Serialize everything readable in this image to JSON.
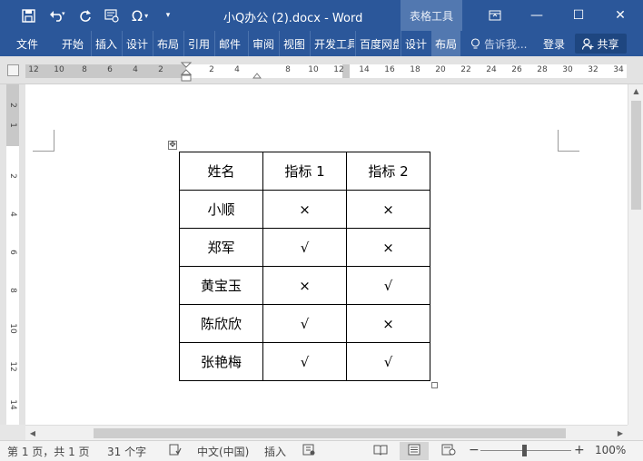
{
  "app": {
    "title": "小Q办公 (2).docx - Word",
    "context_tab": "表格工具"
  },
  "quick_access": {
    "save_icon": "save-icon",
    "undo_icon": "undo-icon",
    "redo_icon": "redo-icon",
    "omega_icon": "symbol-icon",
    "customize_icon": "customize-icon"
  },
  "window_controls": {
    "ribbon_display": "▭",
    "minimize": "—",
    "maximize": "☐",
    "close": "✕"
  },
  "ribbon": {
    "tabs": [
      "文件",
      "开始",
      "插入",
      "设计",
      "布局",
      "引用",
      "邮件",
      "审阅",
      "视图",
      "开发工具",
      "百度网盘",
      "设计",
      "布局"
    ],
    "active_tab_index": 12,
    "tell_me": "告诉我...",
    "login": "登录",
    "share": "共享"
  },
  "ruler": {
    "h_numbers_left": [
      "12",
      "10",
      "8",
      "6",
      "4",
      "2"
    ],
    "h_numbers_mid": [
      "2",
      "4"
    ],
    "h_numbers_right": [
      "8",
      "10",
      "12",
      "14",
      "16",
      "18",
      "20",
      "22",
      "24",
      "26",
      "28",
      "30",
      "32",
      "34"
    ],
    "v_numbers": [
      "2",
      "1",
      "2",
      "4",
      "6",
      "8",
      "10",
      "12",
      "14"
    ]
  },
  "table": {
    "rows": [
      [
        "姓名",
        "指标 1",
        "指标 2"
      ],
      [
        "小顺",
        "×",
        "×"
      ],
      [
        "郑军",
        "√",
        "×"
      ],
      [
        "黄宝玉",
        "×",
        "√"
      ],
      [
        "陈欣欣",
        "√",
        "×"
      ],
      [
        "张艳梅",
        "√",
        "√"
      ]
    ]
  },
  "status": {
    "page": "第 1 页，共 1 页",
    "words": "31 个字",
    "language": "中文(中国)",
    "insert_mode": "插入",
    "zoom": "100%",
    "zoom_minus": "−",
    "zoom_plus": "+"
  }
}
